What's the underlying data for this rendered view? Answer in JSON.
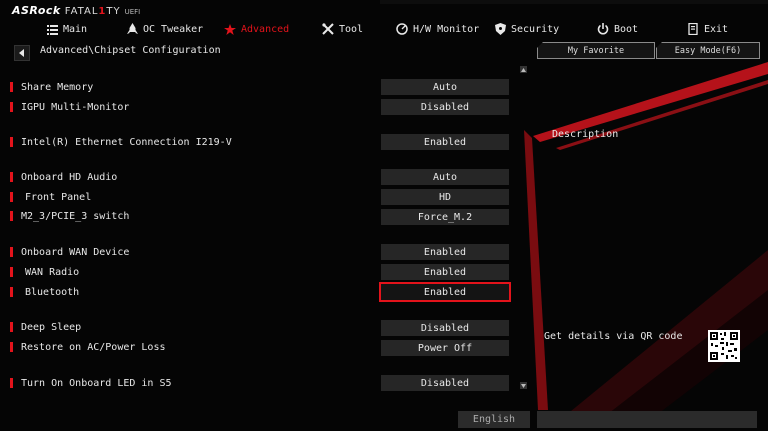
{
  "logo": {
    "brand": "ASRock",
    "fatal_a": "FATAL",
    "fatal_one": "1",
    "fatal_b": "TY",
    "uefi": "UEFI"
  },
  "nav": [
    {
      "label": "Main",
      "icon": "list-icon"
    },
    {
      "label": "OC Tweaker",
      "icon": "rocket-icon"
    },
    {
      "label": "Advanced",
      "icon": "star-icon",
      "active": true
    },
    {
      "label": "Tool",
      "icon": "tools-icon"
    },
    {
      "label": "H/W Monitor",
      "icon": "monitor-icon"
    },
    {
      "label": "Security",
      "icon": "shield-icon"
    },
    {
      "label": "Boot",
      "icon": "power-icon"
    },
    {
      "label": "Exit",
      "icon": "exit-icon"
    }
  ],
  "breadcrumb": "Advanced\\Chipset Configuration",
  "buttons": {
    "favorite": "My Favorite",
    "easy_mode": "Easy Mode(F6)"
  },
  "settings": [
    {
      "label": "Share Memory",
      "value": "Auto"
    },
    {
      "label": "IGPU Multi-Monitor",
      "value": "Disabled"
    },
    {
      "label": "Intel(R) Ethernet Connection I219-V",
      "value": "Enabled"
    },
    {
      "label": "Onboard HD Audio",
      "value": "Auto"
    },
    {
      "label": "Front Panel",
      "value": "HD"
    },
    {
      "label": "M2_3/PCIE_3 switch",
      "value": "Force_M.2"
    },
    {
      "label": "Onboard WAN Device",
      "value": "Enabled"
    },
    {
      "label": "WAN Radio",
      "value": "Enabled"
    },
    {
      "label": "Bluetooth",
      "value": "Enabled"
    },
    {
      "label": "Deep Sleep",
      "value": "Disabled"
    },
    {
      "label": "Restore on AC/Power Loss",
      "value": "Power Off"
    },
    {
      "label": "Turn On Onboard LED in S5",
      "value": "Disabled"
    }
  ],
  "panel": {
    "description_title": "Description",
    "qr_text": "Get details via QR code"
  },
  "footer": {
    "language": "English"
  },
  "colors": {
    "accent": "#e3131b",
    "background": "#050505",
    "value_bg": "#262626"
  }
}
